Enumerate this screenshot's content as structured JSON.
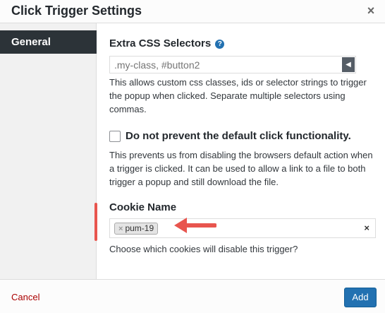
{
  "dialog": {
    "title": "Click Trigger Settings",
    "close_glyph": "×"
  },
  "sidebar": {
    "items": [
      {
        "label": "General",
        "active": true
      }
    ]
  },
  "fields": {
    "extra_css": {
      "label": "Extra CSS Selectors",
      "help_glyph": "?",
      "placeholder": ".my-class, #button2",
      "value": "",
      "arrow_glyph": "◀",
      "description": "This allows custom css classes, ids or selector strings to trigger the popup when clicked. Separate multiple selectors using commas."
    },
    "do_not_prevent_default": {
      "label": "Do not prevent the default click functionality.",
      "checked": false,
      "description": "This prevents us from disabling the browsers default action when a trigger is clicked. It can be used to allow a link to a file to both trigger a popup and still download the file."
    },
    "cookie_name": {
      "label": "Cookie Name",
      "selected": [
        {
          "label": "pum-19",
          "remove_glyph": "×"
        }
      ],
      "clear_glyph": "×",
      "description": "Choose which cookies will disable this trigger?"
    }
  },
  "footer": {
    "cancel_label": "Cancel",
    "add_label": "Add"
  },
  "annotation": {
    "color": "#e8554e"
  },
  "colors": {
    "sidebar_active_bg": "#2c3338",
    "primary_button": "#2271b1",
    "cancel_link": "#aa0000"
  }
}
